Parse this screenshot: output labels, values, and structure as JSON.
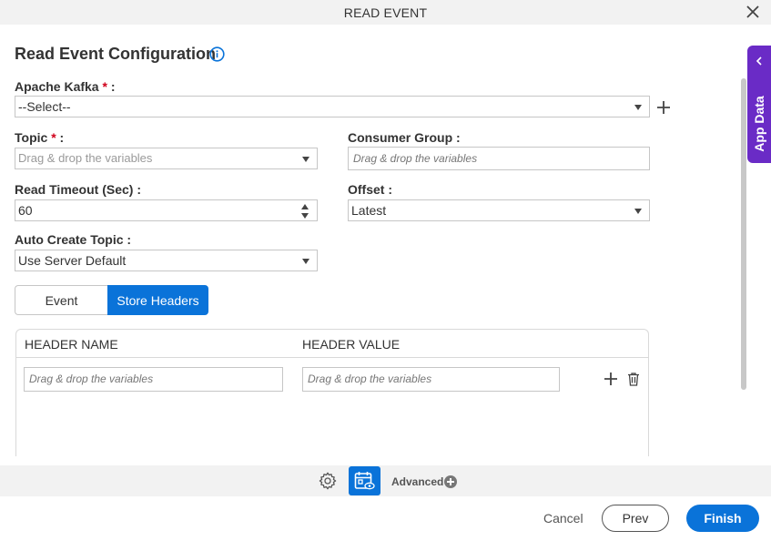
{
  "window": {
    "title": "READ EVENT"
  },
  "side_tab": {
    "label": "App Data"
  },
  "form": {
    "heading": "Read Event Configuration",
    "apache_kafka": {
      "label": "Apache Kafka",
      "required": "*",
      "colon": " :",
      "value": "--Select--"
    },
    "topic": {
      "label": "Topic",
      "required": "*",
      "colon": " :",
      "placeholder": "Drag & drop the variables"
    },
    "consumer_group": {
      "label": "Consumer Group :",
      "placeholder": "Drag & drop the variables"
    },
    "read_timeout": {
      "label": "Read Timeout (Sec) :",
      "value": "60"
    },
    "offset": {
      "label": "Offset :",
      "value": "Latest"
    },
    "auto_create_topic": {
      "label": "Auto Create Topic :",
      "value": "Use Server Default"
    }
  },
  "tabs": [
    {
      "label": "Event",
      "active": false
    },
    {
      "label": "Store Headers",
      "active": true
    }
  ],
  "headers_table": {
    "columns": [
      "HEADER NAME",
      "HEADER VALUE"
    ],
    "rows": [
      {
        "name_placeholder": "Drag & drop the variables",
        "value_placeholder": "Drag & drop the variables"
      }
    ]
  },
  "toolbar": {
    "advanced_label": "Advanced"
  },
  "footer": {
    "cancel": "Cancel",
    "prev": "Prev",
    "finish": "Finish"
  },
  "colors": {
    "primary": "#0a73d9",
    "side_tab": "#6a2bc6",
    "required": "#d0021b"
  }
}
